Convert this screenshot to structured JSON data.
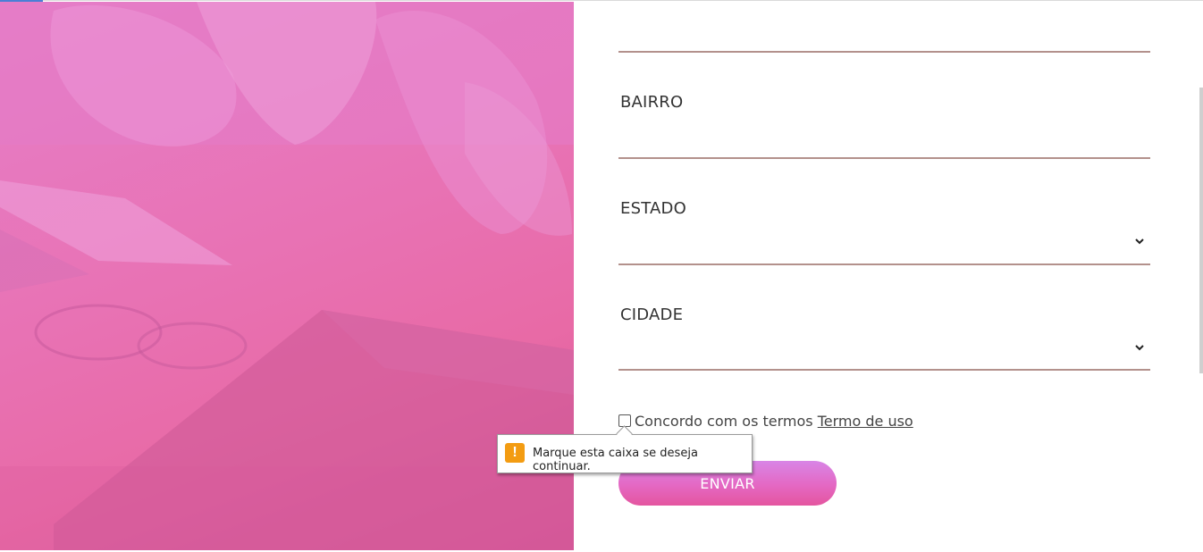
{
  "form": {
    "fields": [
      {
        "label": ""
      },
      {
        "label": "BAIRRO"
      },
      {
        "label": "ESTADO"
      },
      {
        "label": "CIDADE"
      }
    ],
    "consent": {
      "text": "Concordo com os termos",
      "link": "Termo de uso"
    },
    "submit_label": "ENVIAR"
  },
  "tooltip": {
    "icon": "warning-icon",
    "message": "Marque esta caixa se deseja continuar."
  },
  "colors": {
    "accent_pink": "#e86aa6",
    "field_line": "#b3918c",
    "warning": "#f39c12"
  }
}
